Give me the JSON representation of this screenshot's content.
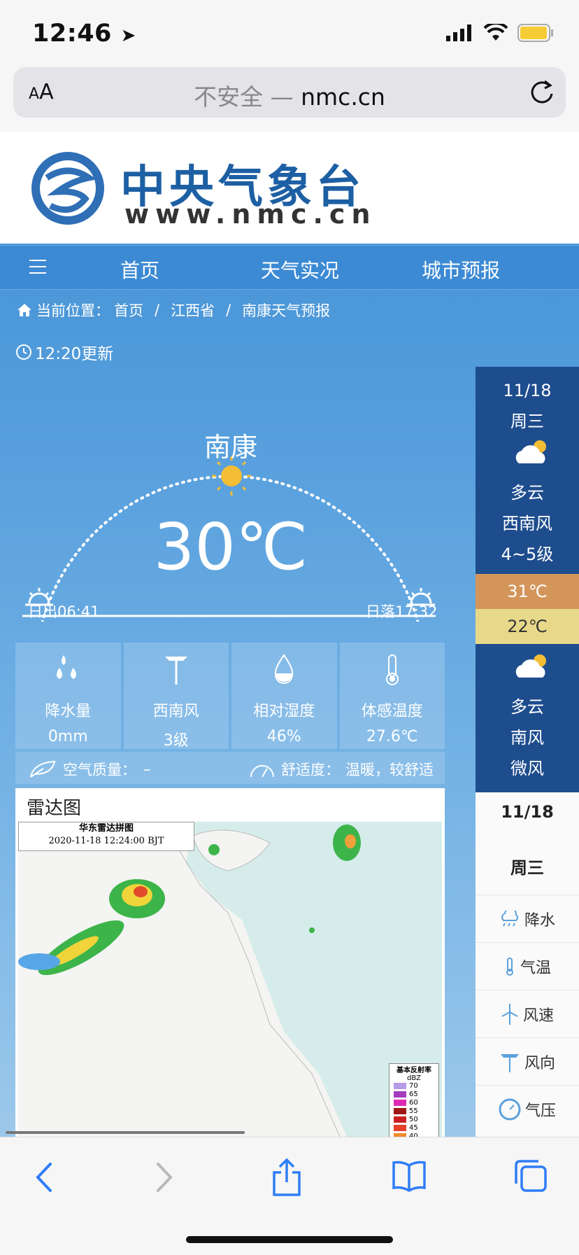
{
  "status_bar": {
    "time": "12:46"
  },
  "browser": {
    "aa_label": "AA",
    "insecure": "不安全",
    "separator": " — ",
    "domain": "nmc.cn"
  },
  "site": {
    "title": "中央气象台",
    "url": "www.nmc.cn"
  },
  "nav": {
    "items": [
      "首页",
      "天气实况",
      "城市预报"
    ]
  },
  "breadcrumb": {
    "label": "当前位置：",
    "items": [
      "首页",
      "江西省",
      "南康天气预报"
    ]
  },
  "updated": "12:20更新",
  "current": {
    "city": "南康",
    "temperature": "30℃",
    "sunrise": "日出06:41",
    "sunset": "日落17:32"
  },
  "stats": [
    {
      "label": "降水量",
      "value": "0mm",
      "icon": "raindrops-icon"
    },
    {
      "label": "西南风",
      "value": "3级",
      "icon": "wind-turbine-icon"
    },
    {
      "label": "相对湿度",
      "value": "46%",
      "icon": "humidity-drop-icon"
    },
    {
      "label": "体感温度",
      "value": "27.6℃",
      "icon": "thermometer-icon"
    }
  ],
  "air": {
    "label": "空气质量：",
    "value": "–",
    "comfort_label": "舒适度：",
    "comfort_value": "温暖，较舒适"
  },
  "radar": {
    "title": "雷达图",
    "image_label_1": "华东雷达拼图",
    "image_label_2": "2020-11-18 12:24:00 BJT",
    "legend_title": "基本反射率",
    "legend_unit": "dBZ",
    "legend_values": [
      "70",
      "65",
      "60",
      "55",
      "50",
      "45",
      "40"
    ]
  },
  "forecast_today": {
    "date": "11/18",
    "weekday": "周三",
    "day_weather": "多云",
    "day_wind_dir": "西南风",
    "day_wind_level": "4~5级",
    "high": "31℃",
    "low": "22℃",
    "night_weather": "多云",
    "night_wind_dir": "南风",
    "night_wind_level": "微风"
  },
  "side_panel": {
    "date": "11/18",
    "weekday": "周三",
    "items": [
      "降水",
      "气温",
      "风速",
      "风向",
      "气压"
    ]
  },
  "colors": {
    "nav_bg": "#3c8ad4",
    "forecast_bg": "#1e4d8e",
    "high_bg": "#d4955a",
    "low_bg": "#e8d98a"
  }
}
